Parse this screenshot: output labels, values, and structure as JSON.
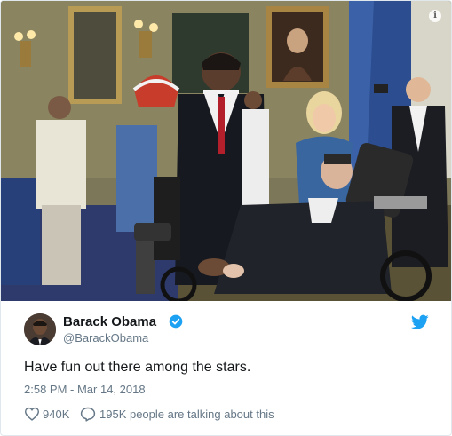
{
  "tweet": {
    "author": {
      "display_name": "Barack Obama",
      "handle": "@BarackObama",
      "verified": true
    },
    "text": "Have fun out there among the stars.",
    "timestamp": "2:58 PM - Mar 14, 2018",
    "likes": "940K",
    "conversation": "195K people are talking about this"
  },
  "icons": {
    "info": "info-icon",
    "verified": "verified-badge-icon",
    "brand": "twitter-bird-icon",
    "like": "heart-icon",
    "reply": "speech-bubble-icon"
  },
  "colors": {
    "twitter_blue": "#1da1f2",
    "text_primary": "#14171a",
    "text_secondary": "#657786",
    "border": "#e1e8ed"
  }
}
